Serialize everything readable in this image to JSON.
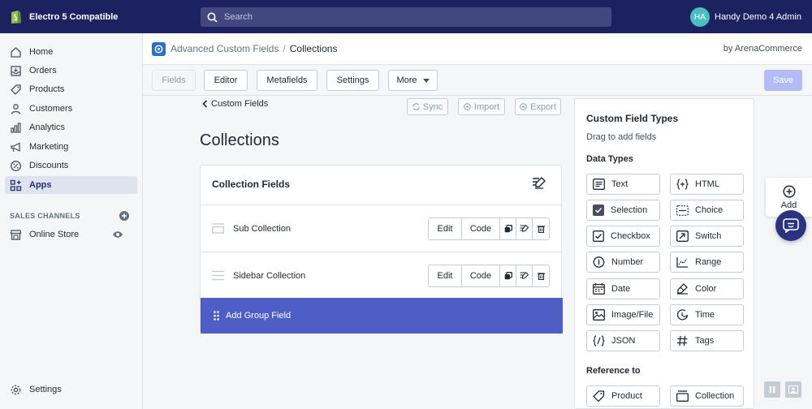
{
  "topbar": {
    "store_name": "Electro 5 Compatible",
    "search_placeholder": "Search",
    "avatar_initials": "HA",
    "account_name": "Handy Demo 4 Admin"
  },
  "sidebar": {
    "items": [
      {
        "label": "Home",
        "icon": "home-icon"
      },
      {
        "label": "Orders",
        "icon": "orders-icon"
      },
      {
        "label": "Products",
        "icon": "tag-icon"
      },
      {
        "label": "Customers",
        "icon": "person-icon"
      },
      {
        "label": "Analytics",
        "icon": "bar-chart-icon"
      },
      {
        "label": "Marketing",
        "icon": "megaphone-icon"
      },
      {
        "label": "Discounts",
        "icon": "discount-icon"
      },
      {
        "label": "Apps",
        "icon": "apps-icon"
      }
    ],
    "sales_channels_label": "SALES CHANNELS",
    "online_store_label": "Online Store",
    "settings_label": "Settings"
  },
  "header": {
    "app_name": "Advanced Custom Fields",
    "separator": "/",
    "current_page": "Collections",
    "by_label": "by ArenaCommerce"
  },
  "toolbar": {
    "fields": "Fields",
    "editor": "Editor",
    "metafields": "Metafields",
    "settings": "Settings",
    "more": "More",
    "save": "Save"
  },
  "main": {
    "back_label": "Custom Fields",
    "sync_label": "Sync",
    "import_label": "Import",
    "export_label": "Export",
    "page_title": "Collections",
    "card_title": "Collection Fields",
    "fields": [
      {
        "name": "Sub Collection",
        "edit": "Edit",
        "code": "Code"
      },
      {
        "name": "Sidebar Collection",
        "edit": "Edit",
        "code": "Code"
      }
    ],
    "add_group_label": "Add Group Field"
  },
  "types_panel": {
    "title": "Custom Field Types",
    "subtitle": "Drag to add fields",
    "data_types_label": "Data Types",
    "data_types": [
      {
        "label": "Text",
        "icon": "text-icon"
      },
      {
        "label": "HTML",
        "icon": "html-icon"
      },
      {
        "label": "Selection",
        "icon": "selection-icon"
      },
      {
        "label": "Choice",
        "icon": "choice-icon"
      },
      {
        "label": "Checkbox",
        "icon": "checkbox-icon"
      },
      {
        "label": "Switch",
        "icon": "switch-icon"
      },
      {
        "label": "Number",
        "icon": "number-icon"
      },
      {
        "label": "Range",
        "icon": "range-icon"
      },
      {
        "label": "Date",
        "icon": "calendar-icon"
      },
      {
        "label": "Color",
        "icon": "color-icon"
      },
      {
        "label": "Image/File",
        "icon": "image-icon"
      },
      {
        "label": "Time",
        "icon": "time-icon"
      },
      {
        "label": "JSON",
        "icon": "json-icon"
      },
      {
        "label": "Tags",
        "icon": "hash-icon"
      }
    ],
    "reference_label": "Reference to",
    "reference_types": [
      {
        "label": "Product",
        "icon": "tag-icon"
      },
      {
        "label": "Collection",
        "icon": "collection-icon"
      }
    ]
  },
  "floating": {
    "add_label": "Add"
  },
  "colors": {
    "topbar": "#1c2260",
    "primary": "#4f5ec7",
    "save_disabled": "#b3bcf5",
    "active_nav": "#202e78"
  }
}
